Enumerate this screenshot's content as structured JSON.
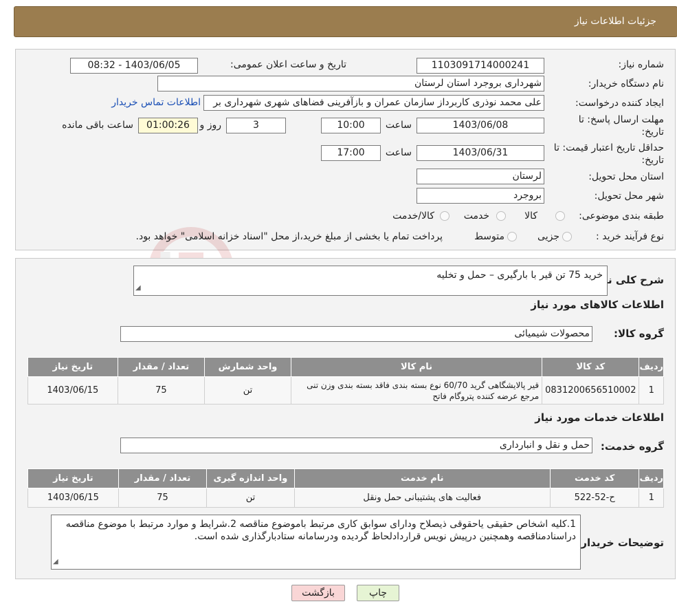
{
  "header": {
    "title": "جزئیات اطلاعات نیاز"
  },
  "info": {
    "need_number_label": "شماره نیاز:",
    "need_number": "1103091714000241",
    "announce_label": "تاریخ و ساعت اعلان عمومی:",
    "announce_value": "1403/06/05 - 08:32",
    "buyer_label": "نام دستگاه خریدار:",
    "buyer_value": "شهرداری بروجرد استان لرستان",
    "creator_label": "ایجاد کننده درخواست:",
    "creator_value": "علی محمد نوذری کاربرداز سازمان عمران و بازآفرینی فضاهای شهری شهرداری بر",
    "contact_link": "اطلاعات تماس خریدار",
    "deadline_label_1": "مهلت ارسال پاسخ: تا",
    "deadline_label_2": "تاریخ:",
    "deadline_date": "1403/06/08",
    "time_label": "ساعت",
    "deadline_time": "10:00",
    "days_value": "3",
    "days_label": "روز و",
    "remaining_value": "01:00:26",
    "remaining_label": "ساعت باقی مانده",
    "validity_label_1": "حداقل تاریخ اعتبار قیمت: تا",
    "validity_label_2": "تاریخ:",
    "validity_date": "1403/06/31",
    "validity_time_label": "ساعت",
    "validity_time": "17:00",
    "province_label": "استان محل تحویل:",
    "province_value": "لرستان",
    "city_label": "شهر محل تحویل:",
    "city_value": "بروجرد",
    "category_label": "طبقه بندی موضوعی:",
    "category_options": [
      "کالا",
      "خدمت",
      "کالا/خدمت"
    ],
    "process_label": "نوع فرآیند خرید :",
    "process_options": [
      "جزیی",
      "متوسط"
    ],
    "process_note": "پرداخت تمام یا بخشی از مبلغ خرید،از محل \"اسناد خزانه اسلامی\" خواهد بود."
  },
  "details": {
    "summary_label": "شرح کلی نیاز:",
    "summary_value": "خرید 75 تن قیر با بارگیری – حمل و تخلیه",
    "goods_section": "اطلاعات کالاهای مورد نیاز",
    "goods_group_label": "گروه کالا:",
    "goods_group_value": "محصولات شیمیائی",
    "goods_table": {
      "headers": [
        "ردیف",
        "کد کالا",
        "نام کالا",
        "واحد شمارش",
        "تعداد / مقدار",
        "تاریخ نیاز"
      ],
      "rows": [
        [
          "1",
          "0831200656510002",
          "قیر پالایشگاهی گرید 60/70 نوع بسته بندی فاقد بسته بندی وزن تنی مرجع عرضه کننده پتروگام فاتح",
          "تن",
          "75",
          "1403/06/15"
        ]
      ]
    },
    "services_section": "اطلاعات خدمات مورد نیاز",
    "service_group_label": "گروه خدمت:",
    "service_group_value": "حمل و نقل و انبارداری",
    "services_table": {
      "headers": [
        "ردیف",
        "کد خدمت",
        "نام خدمت",
        "واحد اندازه گیری",
        "تعداد / مقدار",
        "تاریخ نیاز"
      ],
      "rows": [
        [
          "1",
          "ح-52-522",
          "فعالیت های پشتیبانی حمل ونقل",
          "تن",
          "75",
          "1403/06/15"
        ]
      ]
    },
    "buyer_notes_label": "توضیحات خریدار:",
    "buyer_notes_value": "1.کلیه اشخاص حقیقی یاحقوقی ذیصلاح ودارای سوابق کاری مرتبط باموضوع مناقصه 2.شرایط و موارد مرتبط با موضوع مناقصه دراسنادمناقصه وهمچنین درپیش نویس قراردادلحاظ گردیده ودرسامانه ستادبارگذاری شده است."
  },
  "buttons": {
    "print": "چاپ",
    "back": "بازگشت"
  },
  "colors": {
    "header": "#9b7d4f",
    "link": "#1a4fb5",
    "yellow_box": "#fffbd6",
    "back_button": "#f9d6d6",
    "print_button": "#e6f4d4"
  }
}
